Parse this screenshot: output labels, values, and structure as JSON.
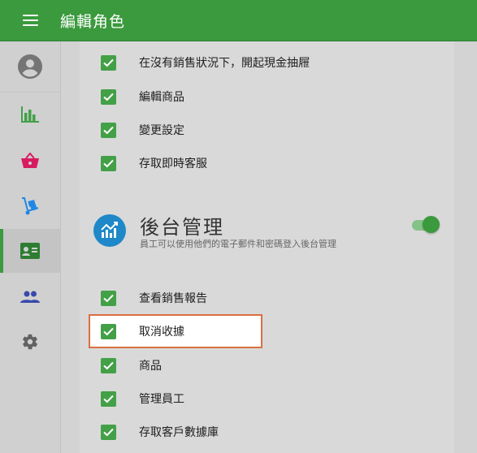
{
  "header": {
    "title": "編輯角色",
    "background_color": "#3a9a3d"
  },
  "sidebar": {
    "items": [
      {
        "icon": "account-circle-icon",
        "color": "#757575"
      },
      {
        "icon": "bar-chart-icon",
        "color": "#43a047"
      },
      {
        "icon": "shopping-basket-icon",
        "color": "#d81b60"
      },
      {
        "icon": "hand-truck-icon",
        "color": "#1e88e5"
      },
      {
        "icon": "id-card-icon",
        "color": "#2e7d32",
        "active": true
      },
      {
        "icon": "people-icon",
        "color": "#3949ab"
      },
      {
        "icon": "settings-gear-icon",
        "color": "#616161"
      }
    ]
  },
  "pos_permissions": [
    {
      "label": "在沒有銷售狀況下，開起現金抽屜",
      "checked": true
    },
    {
      "label": "編輯商品",
      "checked": true
    },
    {
      "label": "變更設定",
      "checked": true
    },
    {
      "label": "存取即時客服",
      "checked": true
    }
  ],
  "backoffice": {
    "title": "後台管理",
    "description": "員工可以使用他們的電子郵件和密碼登入後台管理",
    "enabled": true,
    "icon": "trending-up-chart-icon",
    "icon_color": "#1e88c8",
    "permissions": [
      {
        "label": "查看銷售報告",
        "checked": true
      },
      {
        "label": "取消收據",
        "checked": true,
        "highlighted": true
      },
      {
        "label": "商品",
        "checked": true
      },
      {
        "label": "管理員工",
        "checked": true
      },
      {
        "label": "存取客戶數據庫",
        "checked": true
      }
    ]
  },
  "colors": {
    "checkbox": "#43a047",
    "highlight_border": "#d9703f"
  }
}
